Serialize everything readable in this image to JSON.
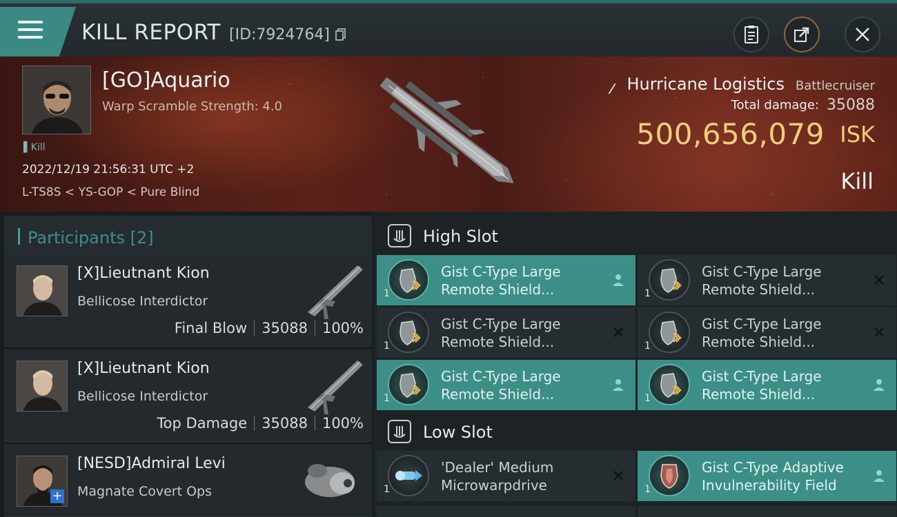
{
  "header": {
    "title": "KILL REPORT",
    "report_id": "[ID:7924764]"
  },
  "victim": {
    "name": "[GO]Aquario",
    "scramble": "Warp Scramble Strength: 4.0",
    "kill_tag": "Kill",
    "datetime": "2022/12/19 21:56:31 UTC +2",
    "location": "L-TS8S < YS-GOP < Pure Blind",
    "ship_name": "Hurricane Logistics",
    "ship_class": "Battlecruiser",
    "damage_label": "Total damage:",
    "damage_value": "35088",
    "isk_value": "500,656,079",
    "isk_unit": "ISK",
    "result": "Kill"
  },
  "participants": {
    "header": "Participants [2]",
    "items": [
      {
        "name": "[X]Lieutnant Kion",
        "ship": "Bellicose Interdictor",
        "role": "Final Blow",
        "damage": "35088",
        "percent": "100%"
      },
      {
        "name": "[X]Lieutnant Kion",
        "ship": "Bellicose Interdictor",
        "role": "Top Damage",
        "damage": "35088",
        "percent": "100%"
      },
      {
        "name": "[NESD]Admiral Levi",
        "ship": "Magnate Covert Ops"
      }
    ]
  },
  "high_slot": {
    "title": "High Slot",
    "items": [
      {
        "line1": "Gist C-Type Large",
        "line2": "Remote Shield...",
        "qty": "1",
        "state": "kept"
      },
      {
        "line1": "Gist C-Type Large",
        "line2": "Remote Shield...",
        "qty": "1",
        "state": "destroyed"
      },
      {
        "line1": "Gist C-Type Large",
        "line2": "Remote Shield...",
        "qty": "1",
        "state": "destroyed"
      },
      {
        "line1": "Gist C-Type Large",
        "line2": "Remote Shield...",
        "qty": "1",
        "state": "destroyed"
      },
      {
        "line1": "Gist C-Type Large",
        "line2": "Remote Shield...",
        "qty": "1",
        "state": "kept"
      },
      {
        "line1": "Gist C-Type Large",
        "line2": "Remote Shield...",
        "qty": "1",
        "state": "kept"
      }
    ]
  },
  "low_slot": {
    "title": "Low Slot",
    "items": [
      {
        "line1": "'Dealer' Medium",
        "line2": "Microwarpdrive",
        "qty": "1",
        "state": "destroyed"
      },
      {
        "line1": "Gist C-Type Adaptive",
        "line2": "Invulnerability Field",
        "qty": "1",
        "state": "kept"
      }
    ]
  },
  "colors": {
    "accent": "#3c8f86",
    "isk": "#f2cf7a",
    "hero_red": "#5a2218"
  },
  "icons": [
    "menu-icon",
    "copy-icon",
    "clipboard-icon",
    "share-icon",
    "close-icon",
    "slot-icon",
    "person-icon",
    "x-icon"
  ]
}
